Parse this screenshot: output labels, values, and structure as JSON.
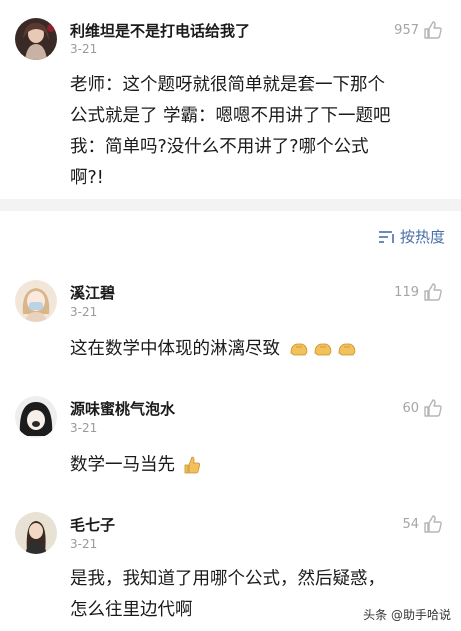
{
  "comments_top": {
    "name": "利维坦是不是打电话给我了",
    "date": "3-21",
    "likes": "957",
    "text_lines": [
      "老师：这个题呀就很简单就是套一下那个",
      "公式就是了 学霸：嗯嗯不用讲了下一题吧",
      "我：简单吗?没什么不用讲了?哪个公式",
      "啊?!"
    ]
  },
  "sort": {
    "label": "按热度",
    "icon": "sort-lines-icon"
  },
  "comments": [
    {
      "name": "溪江碧",
      "date": "3-21",
      "likes": "119",
      "text": "这在数学中体现的淋漓尽致"
    },
    {
      "name": "源味蜜桃气泡水",
      "date": "3-21",
      "likes": "60",
      "text": "数学一马当先"
    },
    {
      "name": "毛七子",
      "date": "3-21",
      "likes": "54",
      "text_lines": [
        "是我，我知道了用哪个公式，然后疑惑，",
        "怎么往里边代啊"
      ]
    }
  ],
  "watermark": "头条 @助手哈说",
  "colors": {
    "accent": "#4a6fa8",
    "muted": "#9a9a9a",
    "divider": "#f3f3f3"
  }
}
